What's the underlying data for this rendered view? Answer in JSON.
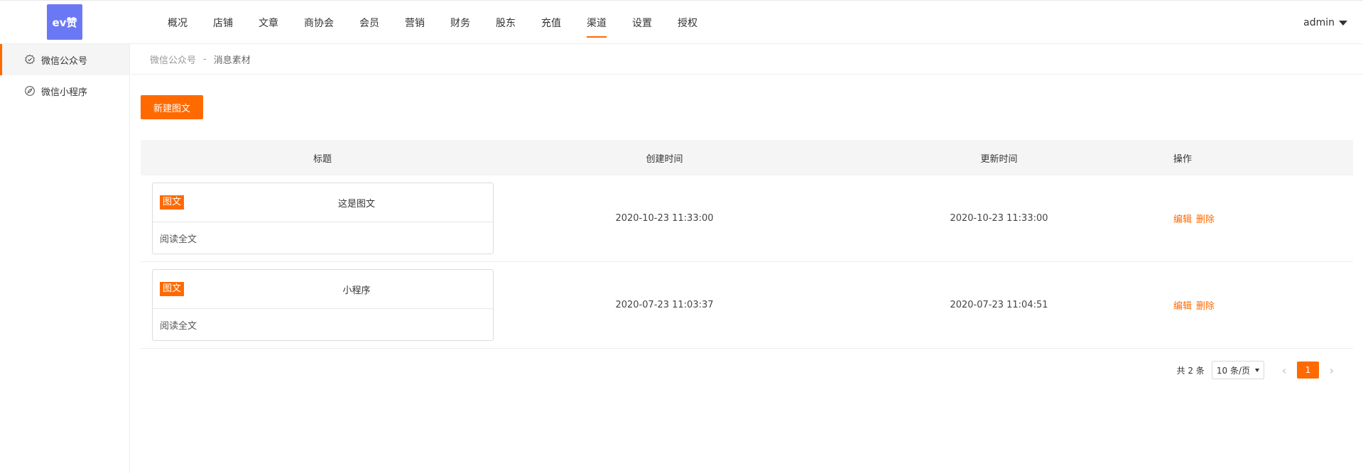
{
  "header": {
    "logo_text": "ev赞",
    "nav": [
      {
        "label": "概况"
      },
      {
        "label": "店铺"
      },
      {
        "label": "文章"
      },
      {
        "label": "商协会"
      },
      {
        "label": "会员"
      },
      {
        "label": "营销"
      },
      {
        "label": "财务"
      },
      {
        "label": "股东"
      },
      {
        "label": "充值"
      },
      {
        "label": "渠道",
        "active": true
      },
      {
        "label": "设置"
      },
      {
        "label": "授权"
      }
    ],
    "user": "admin"
  },
  "sidebar": {
    "items": [
      {
        "label": "微信公众号",
        "icon": "check-badge-icon",
        "active": true
      },
      {
        "label": "微信小程序",
        "icon": "compass-icon"
      }
    ]
  },
  "breadcrumb": {
    "parent": "微信公众号",
    "separator": "-",
    "current": "消息素材"
  },
  "toolbar": {
    "new_button": "新建图文"
  },
  "table": {
    "headers": [
      "标题",
      "创建时间",
      "更新时间",
      "操作"
    ],
    "rows": [
      {
        "tag": "图文",
        "title": "这是图文",
        "read_more": "阅读全文",
        "created": "2020-10-23 11:33:00",
        "updated": "2020-10-23 11:33:00",
        "edit": "编辑",
        "delete": "删除"
      },
      {
        "tag": "图文",
        "title": "小程序",
        "read_more": "阅读全文",
        "created": "2020-07-23 11:03:37",
        "updated": "2020-07-23 11:04:51",
        "edit": "编辑",
        "delete": "删除"
      }
    ]
  },
  "pagination": {
    "total": "共 2 条",
    "page_size": "10 条/页",
    "current_page": "1",
    "prev": "‹",
    "next": "›"
  },
  "colors": {
    "accent": "#ff6a00",
    "logo_bg": "#6b78f5"
  }
}
